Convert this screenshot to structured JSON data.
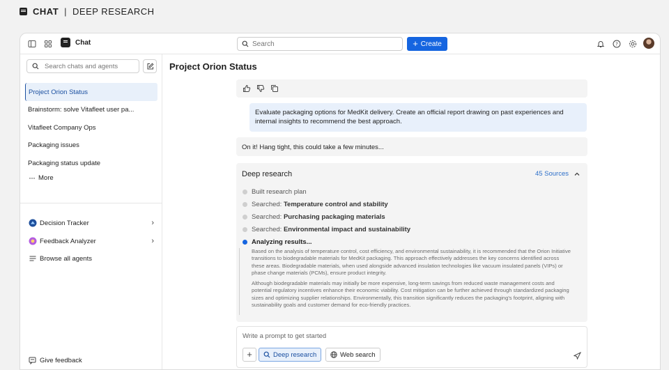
{
  "top_label": {
    "app": "CHAT",
    "section": "DEEP RESEARCH"
  },
  "header": {
    "app_name": "Chat",
    "search_placeholder": "Search",
    "create_label": "Create",
    "icons": [
      "sidebar-toggle-icon",
      "apps-grid-icon",
      "chat-app-icon",
      "bell-icon",
      "help-icon",
      "gear-icon",
      "avatar"
    ]
  },
  "sidebar": {
    "search_placeholder": "Search chats and agents",
    "chats": [
      "Project Orion Status",
      "Brainstorm: solve Vitafleet user pa...",
      "Vitafleet Company Ops",
      "Packaging issues",
      "Packaging status update"
    ],
    "more_label": "More",
    "agents": [
      "Decision Tracker",
      "Feedback Analyzer"
    ],
    "browse_label": "Browse all agents",
    "feedback_label": "Give feedback"
  },
  "main": {
    "title": "Project Orion Status",
    "user_message": "Evaluate packaging options for MedKit delivery. Create an official report drawing on past experiences and internal insights to recommend the best approach.",
    "ack_message": "On it! Hang tight, this could take a few minutes...",
    "deep_research": {
      "title": "Deep research",
      "sources_label": "45 Sources",
      "steps": [
        {
          "prefix": "Built research plan",
          "bold": ""
        },
        {
          "prefix": "Searched: ",
          "bold": "Temperature control and stability"
        },
        {
          "prefix": "Searched: ",
          "bold": "Purchasing packaging materials"
        },
        {
          "prefix": "Searched: ",
          "bold": "Environmental impact and sustainability"
        }
      ],
      "current_step": "Analyzing results...",
      "paragraph_1": "Based on the analysis of temperature control, cost efficiency, and environmental sustainability, it is recommended that the Orion Initiative transitions to biodegradable materials for MedKit packaging. This approach effectively addresses the key concerns identified across these areas. Biodegradable materials, when used alongside advanced insulation technologies like vacuum insulated panels (VIPs) or phase change materials (PCMs), ensure product integrity.",
      "paragraph_2": "Although biodegradable materials may initially be more expensive, long-term savings from reduced waste management costs and potential regulatory incentives enhance their economic viability. Cost mitigation can be further achieved through standardized packaging sizes and optimizing supplier relationships. Environmentally, this transition significantly reduces the packaging's footprint, aligning with sustainability goals and customer demand for eco-friendly practices."
    },
    "prompt": {
      "placeholder": "Write a prompt to get started",
      "deep_research_label": "Deep research",
      "web_search_label": "Web search"
    }
  },
  "colors": {
    "accent": "#1565e0",
    "active_bg": "#e8f0fa",
    "bubble_user": "#e8f0fb",
    "bubble_bot": "#f4f4f4"
  }
}
